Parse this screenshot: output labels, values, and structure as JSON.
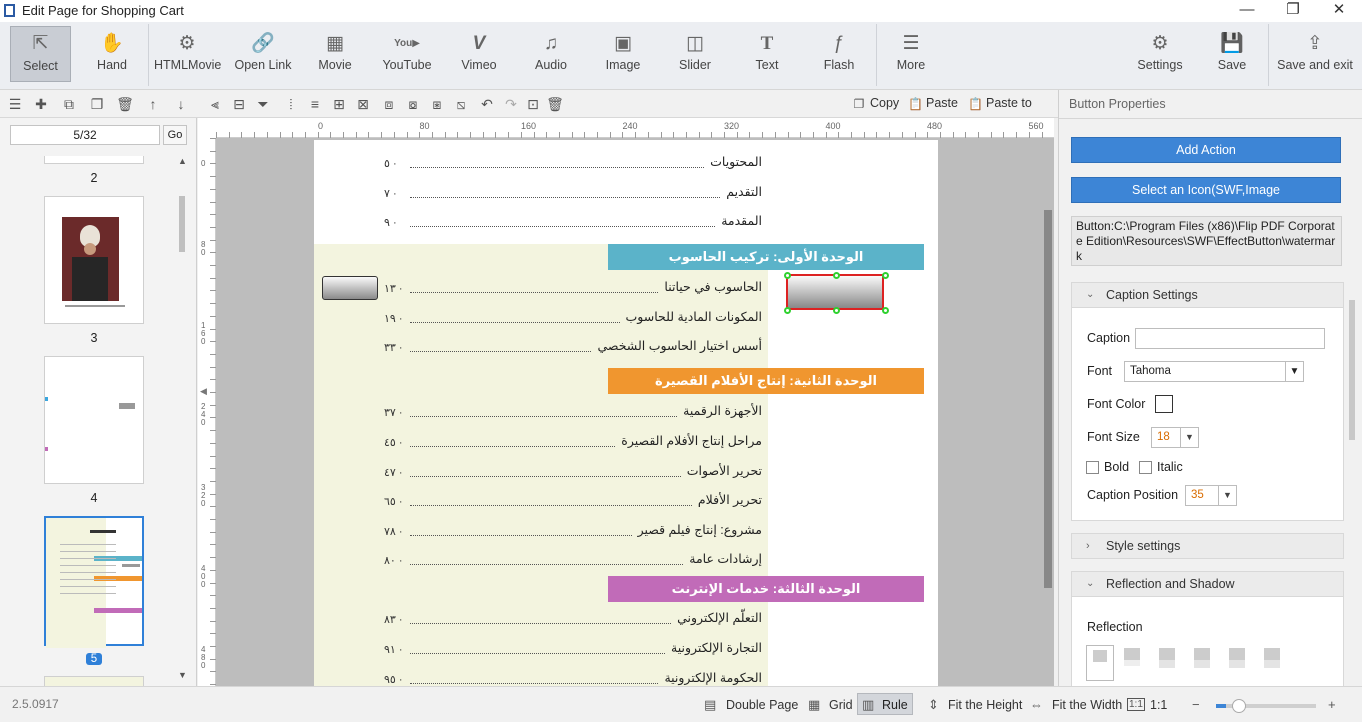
{
  "window": {
    "title": "Edit Page for Shopping Cart",
    "minimize": "—",
    "restore": "❐",
    "close": "✕"
  },
  "ribbon": {
    "select": "Select",
    "hand": "Hand",
    "htmlmovie": "HTMLMovie",
    "openlink": "Open Link",
    "movie": "Movie",
    "youtube": "YouTube",
    "vimeo": "Vimeo",
    "audio": "Audio",
    "image": "Image",
    "slider": "Slider",
    "text": "Text",
    "flash": "Flash",
    "more": "More",
    "settings": "Settings",
    "save": "Save",
    "save_exit": "Save and exit"
  },
  "toolbar": {
    "copy": "Copy",
    "paste": "Paste",
    "paste_to": "Paste to"
  },
  "pages": {
    "current": "5/32",
    "go": "Go",
    "labels": [
      "2",
      "3",
      "4",
      "5"
    ]
  },
  "ruler": {
    "top": [
      "0",
      "80",
      "160",
      "240",
      "320",
      "400",
      "480",
      "560"
    ],
    "left": [
      "0",
      "80",
      "160",
      "240",
      "320",
      "400",
      "480"
    ]
  },
  "toc": {
    "intro": [
      {
        "title": "المحتويات",
        "page": "٥"
      },
      {
        "title": "التقديم",
        "page": "٧"
      },
      {
        "title": "المقدمة",
        "page": "٩"
      }
    ],
    "units": [
      {
        "title": "الوحدة الأولى: تركيب الحاسوب",
        "color": "#5bb3c9",
        "items": [
          {
            "title": "الحاسوب في حياتنا",
            "page": "١٣"
          },
          {
            "title": "المكونات المادية للحاسوب",
            "page": "١٩"
          },
          {
            "title": "أسس اختيار الحاسوب الشخصي",
            "page": "٣٣"
          }
        ]
      },
      {
        "title": "الوحدة الثانية: إنتاج الأفلام القصيرة",
        "color": "#f0962f",
        "items": [
          {
            "title": "الأجهزة الرقمية",
            "page": "٣٧"
          },
          {
            "title": "مراحل إنتاج الأفلام القصيرة",
            "page": "٤٥"
          },
          {
            "title": "تحرير الأصوات",
            "page": "٤٧"
          },
          {
            "title": "تحرير الأفلام",
            "page": "٦٥"
          },
          {
            "title": "مشروع: إنتاج فيلم قصير",
            "page": "٧٨"
          },
          {
            "title": "إرشادات عامة",
            "page": "٨٠"
          }
        ]
      },
      {
        "title": "الوحدة الثالثة: خدمات الإنترنت",
        "color": "#c16bb8",
        "items": [
          {
            "title": "التعلّم الإلكتروني",
            "page": "٨٣"
          },
          {
            "title": "التجارة الإلكترونية",
            "page": "٩١"
          },
          {
            "title": "الحكومة الإلكترونية",
            "page": "٩٥"
          }
        ]
      }
    ]
  },
  "properties": {
    "title": "Button Properties",
    "add_action": "Add Action",
    "select_icon": "Select an Icon(SWF,Image",
    "path": "Button:C:\\Program Files (x86)\\Flip PDF Corporate Edition\\Resources\\SWF\\EffectButton\\watermark",
    "caption_settings": "Caption Settings",
    "caption_label": "Caption",
    "caption_value": "",
    "font_label": "Font",
    "font_value": "Tahoma",
    "font_color_label": "Font Color",
    "font_size_label": "Font Size",
    "font_size_value": "18",
    "bold": "Bold",
    "italic": "Italic",
    "caption_position_label": "Caption Position",
    "caption_position_value": "35",
    "style_settings": "Style settings",
    "reflection_shadow": "Reflection and Shadow",
    "reflection_label": "Reflection"
  },
  "status": {
    "version": "2.5.0917",
    "double_page": "Double Page",
    "grid": "Grid",
    "rule": "Rule",
    "fit_height": "Fit the Height",
    "fit_width": "Fit the Width",
    "one_to_one": "1:1",
    "zoom_percent": 10
  },
  "colors": {
    "accent": "#3d85d6",
    "selection_border": "#2f80d8",
    "handle": "#2fd12f"
  }
}
